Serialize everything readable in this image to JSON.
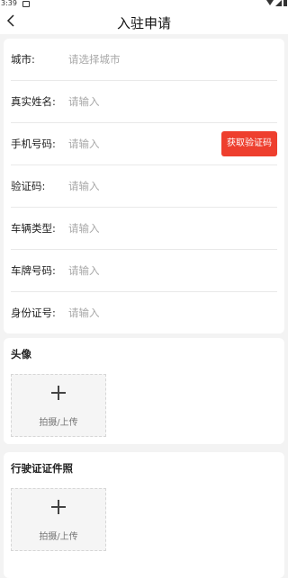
{
  "status": {
    "time": "3:39"
  },
  "header": {
    "title": "入驻申请"
  },
  "form": {
    "city": {
      "label": "城市:",
      "placeholder": "请选择城市"
    },
    "name": {
      "label": "真实姓名:",
      "placeholder": "请输入"
    },
    "phone": {
      "label": "手机号码:",
      "placeholder": "请输入",
      "button": "获取验证码"
    },
    "code": {
      "label": "验证码:",
      "placeholder": "请输入"
    },
    "vehicle_type": {
      "label": "车辆类型:",
      "placeholder": "请输入"
    },
    "plate": {
      "label": "车牌号码:",
      "placeholder": "请输入"
    },
    "id_number": {
      "label": "身份证号:",
      "placeholder": "请输入"
    }
  },
  "uploads": {
    "avatar": {
      "title": "头像",
      "button_text": "拍摄/上传"
    },
    "license": {
      "title": "行驶证证件照",
      "button_text": "拍摄/上传"
    }
  },
  "colors": {
    "accent": "#ee3f2e"
  }
}
